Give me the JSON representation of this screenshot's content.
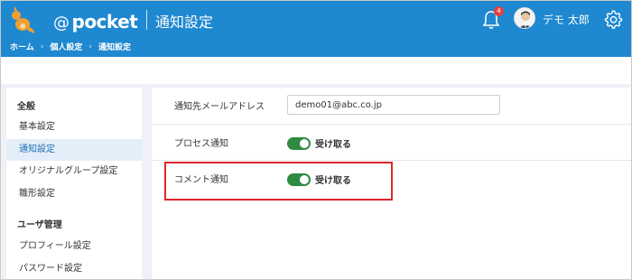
{
  "header": {
    "brand_at": "@",
    "brand_name": "pocket",
    "page_title": "通知設定",
    "breadcrumb": [
      "ホーム",
      "個人設定",
      "通知設定"
    ],
    "breadcrumb_sep": "›",
    "notification_count": "4",
    "user_name": "デモ 太郎",
    "colors": {
      "header_bg": "#1e88d0",
      "badge": "#e84040"
    }
  },
  "sidebar": {
    "groups": [
      {
        "heading": "全般",
        "items": [
          {
            "label": "基本設定",
            "active": false
          },
          {
            "label": "通知設定",
            "active": true
          },
          {
            "label": "オリジナルグループ設定",
            "active": false
          },
          {
            "label": "雛形設定",
            "active": false
          }
        ]
      },
      {
        "heading": "ユーザ管理",
        "items": [
          {
            "label": "プロフィール設定",
            "active": false
          },
          {
            "label": "パスワード設定",
            "active": false
          }
        ]
      }
    ]
  },
  "main": {
    "email": {
      "label": "通知先メールアドレス",
      "value": "demo01@abc.co.jp"
    },
    "process": {
      "label": "プロセス通知",
      "toggle_label": "受け取る",
      "on": true
    },
    "comment": {
      "label": "コメント通知",
      "toggle_label": "受け取る",
      "on": true
    },
    "colors": {
      "toggle_on": "#2e8b3f",
      "highlight": "#e0262b"
    }
  }
}
